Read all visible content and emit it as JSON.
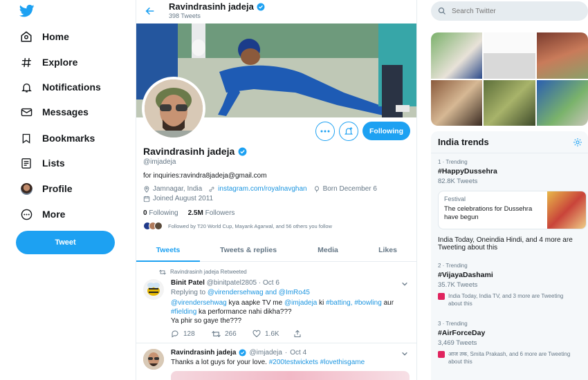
{
  "nav": {
    "items": [
      {
        "label": "Home",
        "icon": "home-icon"
      },
      {
        "label": "Explore",
        "icon": "hashtag-icon"
      },
      {
        "label": "Notifications",
        "icon": "bell-icon"
      },
      {
        "label": "Messages",
        "icon": "envelope-icon"
      },
      {
        "label": "Bookmarks",
        "icon": "bookmark-icon"
      },
      {
        "label": "Lists",
        "icon": "list-icon"
      },
      {
        "label": "Profile",
        "icon": "avatar"
      },
      {
        "label": "More",
        "icon": "more-circle-icon"
      }
    ],
    "tweet_button": "Tweet"
  },
  "header": {
    "name": "Ravindrasinh jadeja",
    "tweet_count": "398 Tweets"
  },
  "profile": {
    "name": "Ravindrasinh jadeja",
    "handle": "@imjadeja",
    "bio": "for inquiries:ravindra8jadeja@gmail.com",
    "location": "Jamnagar, India",
    "link": "instagram.com/royalnavghan",
    "born": "Born December 6",
    "joined": "Joined August 2011",
    "following_count": "0",
    "following_label": "Following",
    "followers_count": "2.5M",
    "followers_label": "Followers",
    "followed_by": "Followed by T20 World Cup, Mayank Agarwal, and 56 others you follow",
    "follow_button": "Following"
  },
  "tabs": [
    "Tweets",
    "Tweets & replies",
    "Media",
    "Likes"
  ],
  "tweets": [
    {
      "retweet_note": "Ravindrasinh jadeja Retweeted",
      "name": "Binit Patel",
      "handle": "@binitpatel2805",
      "date": "Oct 6",
      "reply_prefix": "Replying to",
      "reply_to": "@virendersehwag and @ImRo45",
      "line1_mention1": "@virendersehwag",
      "line1_text": "kya aapke TV me",
      "line1_mention2": "@imjadeja",
      "line1_text2": "ki",
      "line1_tag1": "#batting,",
      "line1_tag2": "#bowling",
      "line1_text3": "aur",
      "line2_tag": "#fielding",
      "line2_text": "ka performance nahi dikha???",
      "line3": "Ya phir so gaye the???",
      "replies": "128",
      "retweets": "266",
      "likes": "1.6K"
    },
    {
      "name": "Ravindrasinh jadeja",
      "handle": "@imjadeja",
      "date": "Oct 4",
      "text": "Thanks a lot guys for your love.",
      "tags": "#200testwickets #lovethisgame"
    }
  ],
  "search": {
    "placeholder": "Search Twitter"
  },
  "trends": {
    "title": "India trends",
    "items": [
      {
        "rank": "1 · Trending",
        "tag": "#HappyDussehra",
        "count": "82.8K Tweets"
      },
      {
        "rank": "2 · Trending",
        "tag": "#VijayaDashami",
        "count": "35.7K Tweets",
        "context": "India Today, India TV, and 3 more are Tweeting about this"
      },
      {
        "rank": "3 · Trending",
        "tag": "#AirForceDay",
        "count": "3,469 Tweets",
        "context": "आज तक, Smita Prakash, and 6 more are Tweeting about this"
      }
    ],
    "festival": {
      "label": "Festival",
      "text": "The celebrations for Dussehra have begun"
    },
    "festival_context": "India Today, Oneindia Hindi, and 4 more are Tweeting about this"
  },
  "colors": {
    "accent": "#1da1f2",
    "link": "#1b95e0",
    "muted": "#657786"
  }
}
